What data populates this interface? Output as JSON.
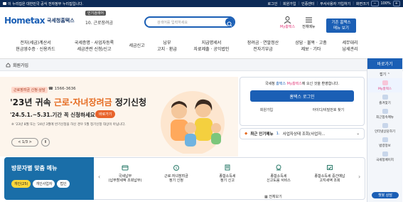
{
  "topbar": {
    "gov_notice": "이 누리집은 대한민국 공식 전자정부 누리집입니다.",
    "links": [
      "로그인",
      "회원가입",
      "인증센터",
      "부서사용자 가입하기",
      "화면크기"
    ],
    "zoom": "100%"
  },
  "header": {
    "logo_mark": "Hometax",
    "logo_ko": "국세청홈택스",
    "hot_label": "인기검색어",
    "keyword": "10. 근로장려금",
    "search_placeholder": "검색어를 입력하세요",
    "icons": [
      {
        "label": "My홈택스",
        "icon": "user-icon"
      },
      {
        "label": "전체메뉴",
        "icon": "menu-icon"
      }
    ],
    "myhome_line1": "기존 홈택스",
    "myhome_line2": "메뉴 보기"
  },
  "gnb": [
    "전자(세금)계산서\n현금영수증 · 신용카드",
    "국세증명 · 사업자등록\n세금관련 신청/신고",
    "세금신고",
    "납부\n고지 · 환급",
    "지급명세서\n자료제출 · 공익법인",
    "장려금 · 연말정산\n전자기부금",
    "상담 · 불복 · 고충\n제보 · 기타",
    "세무대리\n납세관리"
  ],
  "breadcrumb": {
    "text": "회원가입"
  },
  "banner": {
    "tag": "근로장려금 신청·상담",
    "tel": "1566-3636",
    "title_pre": "'23년 귀속 ",
    "title_hl": "근로·자녀장려금",
    "title_post": " 정기신청",
    "period": "'24.5.1.~5.31.기간 꼭 신청하세요!",
    "button": "바로가기",
    "note": "※ '23년 8월 또는 '24년 3월에 반기신청을 하신 경우 5월 정기신청 대상이 아닙니다.",
    "pager": "< 1/3 >",
    "pause": "II"
  },
  "login_box": {
    "welcome_pre": "국세청 ",
    "welcome_brand": "홈택스",
    "welcome_mid": " ",
    "welcome_my": "My홈택스",
    "welcome_post": "에 오신 것을 환영합니다.",
    "login_button": "홈택스 로그인",
    "links": [
      "회원가입",
      "아이디/비밀번호 찾기"
    ]
  },
  "hot_menu": {
    "label": "최근 인기메뉴",
    "num": "1.",
    "text": "사업자상태 조회(사업자..."
  },
  "custom_menu": {
    "title": "방문자별 맞춤 메뉴",
    "pills": [
      "개인(25)",
      "개인사업자",
      "법인"
    ]
  },
  "services": [
    {
      "label": "국세납부\n(납부할세액 조회납부)",
      "icon": "tax-pay-icon"
    },
    {
      "label": "근로·자녀장려금\n정기 신청",
      "icon": "incentive-icon"
    },
    {
      "label": "종합소득세\n정기 신고",
      "icon": "income-tax-icon"
    },
    {
      "label": "종합소득세\n신고도움 서비스",
      "icon": "help-service-icon"
    },
    {
      "label": "종합소득세 중간예납\n고지세액 조회",
      "icon": "interim-tax-icon"
    }
  ],
  "all_view": "전체보기",
  "side_panel": {
    "title": "바로가기",
    "sub": "접기",
    "items": [
      {
        "label": "My홈택스",
        "icon": "my-hometax-icon"
      },
      {
        "label": "즐겨찾기",
        "icon": "star-icon"
      },
      {
        "label": "최근접속메뉴",
        "icon": "recent-icon"
      },
      {
        "label": "인터넷상담하기",
        "icon": "chat-icon"
      },
      {
        "label": "법령정보",
        "icon": "law-icon"
      },
      {
        "label": "국세청페이지",
        "icon": "nts-page-icon"
      }
    ],
    "bottom": "챗봇 상담"
  },
  "colors": {
    "brand": "#1b5fb5",
    "accent": "#e56a1f",
    "pink": "#e23a7b",
    "navy": "#0c2a56"
  }
}
